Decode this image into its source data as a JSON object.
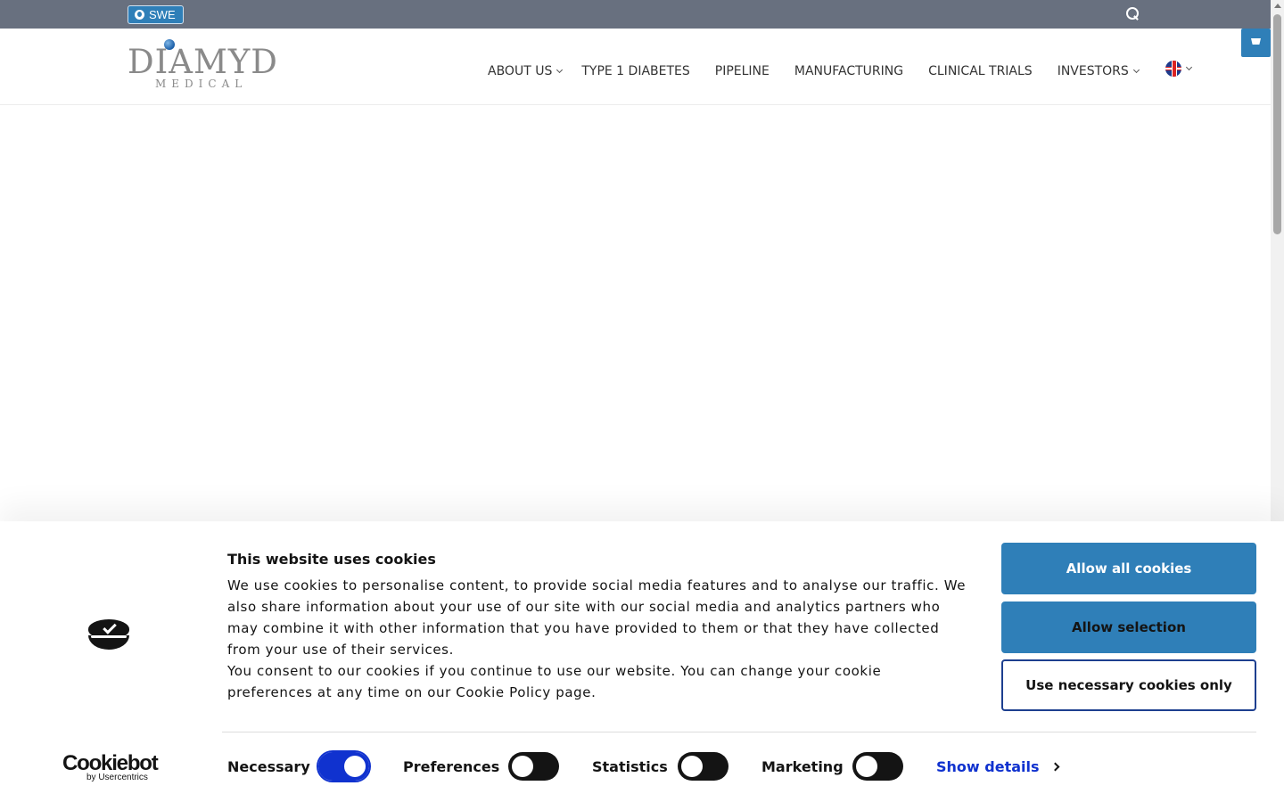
{
  "topbar": {
    "language_label": "SWE"
  },
  "header": {
    "logo_main": "DIAMYD",
    "logo_sub": "MEDICAL",
    "nav": [
      {
        "label": "ABOUT US"
      },
      {
        "label": "TYPE 1 DIABETES"
      },
      {
        "label": "PIPELINE"
      },
      {
        "label": "MANUFACTURING"
      },
      {
        "label": "CLINICAL TRIALS"
      },
      {
        "label": "INVESTORS"
      }
    ]
  },
  "cookie_banner": {
    "title": "This website uses cookies",
    "body_1": "We use cookies to personalise content, to provide social media features and to analyse our traffic. We also share information about your use of our site with our social media and analytics partners who may combine it with other information that you have provided to them or that they have collected from your use of their services.",
    "body_2": "You consent to our cookies if you continue to use our website. You can change your cookie preferences at any time on our Cookie Policy page.",
    "buttons": {
      "allow_all": "Allow all cookies",
      "allow_selection": "Allow selection",
      "necessary_only": "Use necessary cookies only"
    },
    "toggles": [
      {
        "label": "Necessary",
        "on": true
      },
      {
        "label": "Preferences",
        "on": false
      },
      {
        "label": "Statistics",
        "on": false
      },
      {
        "label": "Marketing",
        "on": false
      }
    ],
    "show_details": "Show details",
    "brand": {
      "name": "Cookiebot",
      "byline": "by Usercentrics"
    }
  },
  "colors": {
    "topbar": "#68707f",
    "accent_blue": "#2f7fb8",
    "toggle_on": "#1032cf",
    "link": "#1032cf"
  }
}
